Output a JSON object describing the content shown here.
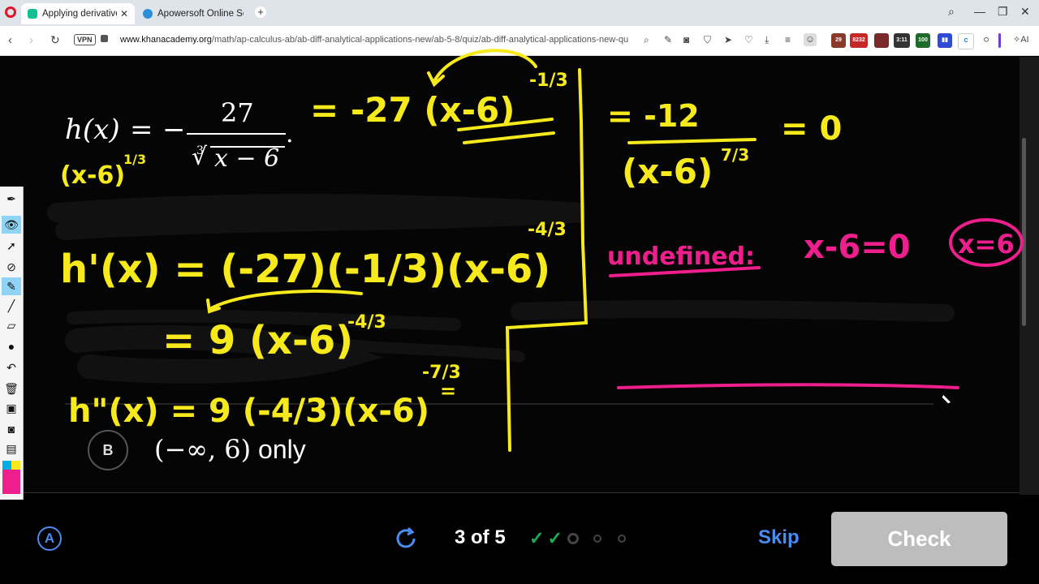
{
  "browser": {
    "tabs": [
      {
        "title": "Applying derivatives to",
        "active": true,
        "favicon_color": "#14bf96"
      },
      {
        "title": "Apowersoft Online Screen",
        "active": false,
        "favicon_color": "#2a8fd8"
      }
    ],
    "url_host": "www.khanacademy.org",
    "url_path": "/math/ap-calculus-ab/ab-diff-analytical-applications-new/ab-5-8/quiz/ab-diff-analytical-applications-new-qu",
    "vpn_label": "VPN",
    "extension_badges": [
      "29",
      "8232",
      "3:11",
      "100"
    ],
    "ai_label": "AI"
  },
  "problem": {
    "function_lhs": "h(x)",
    "equals": "=",
    "minus": "−",
    "numerator": "27",
    "root_index": "3",
    "radicand": "x − 6",
    "period": "."
  },
  "annotations": {
    "yellow": {
      "rewrite_denominator": "(x-6)",
      "rewrite_denominator_exp": "1/3",
      "rewrite_rhs": "= -27 (x-6)",
      "rewrite_rhs_exp": "-1/3",
      "first_derivative": "h'(x) = (-27)(-1/3)(x-6)",
      "first_derivative_exp": "-4/3",
      "first_derivative_simplified": "= 9 (x-6)",
      "first_derivative_simplified_exp": "-4/3",
      "second_derivative": "h\"(x) = 9 (-4/3)(x-6)",
      "second_derivative_exp": "-7/3",
      "second_derivative_trail": "=",
      "result_numerator": "= -12",
      "result_denominator": "(x-6)",
      "result_denominator_exp": "7/3",
      "result_equals_zero": "= 0"
    },
    "pink": {
      "undefined_label": "undefined:",
      "undefined_equation": "x-6=0",
      "undefined_answer": "x=6"
    },
    "ink_colors": {
      "yellow": "#f7ea1c",
      "pink": "#ee1f8c"
    }
  },
  "answer_choice": {
    "letter": "B",
    "text_math": "(−∞, 6)",
    "text_suffix": " only"
  },
  "footer": {
    "progress": "3 of 5",
    "checks_done": 2,
    "skip_label": "Skip",
    "check_label": "Check",
    "accent_color": "#4a8cf0"
  },
  "pen_toolbar": {
    "tools": [
      "pen-icon",
      "eye-icon",
      "pointer-icon",
      "crosshair-icon",
      "marker-icon",
      "line-icon",
      "eraser-icon",
      "dot-icon",
      "undo-icon",
      "trash-icon",
      "screen-icon",
      "camera-icon",
      "notes-icon"
    ],
    "palette": [
      "#00aee6",
      "#f7ea1c",
      "#000000",
      "#ee1f8c"
    ]
  }
}
